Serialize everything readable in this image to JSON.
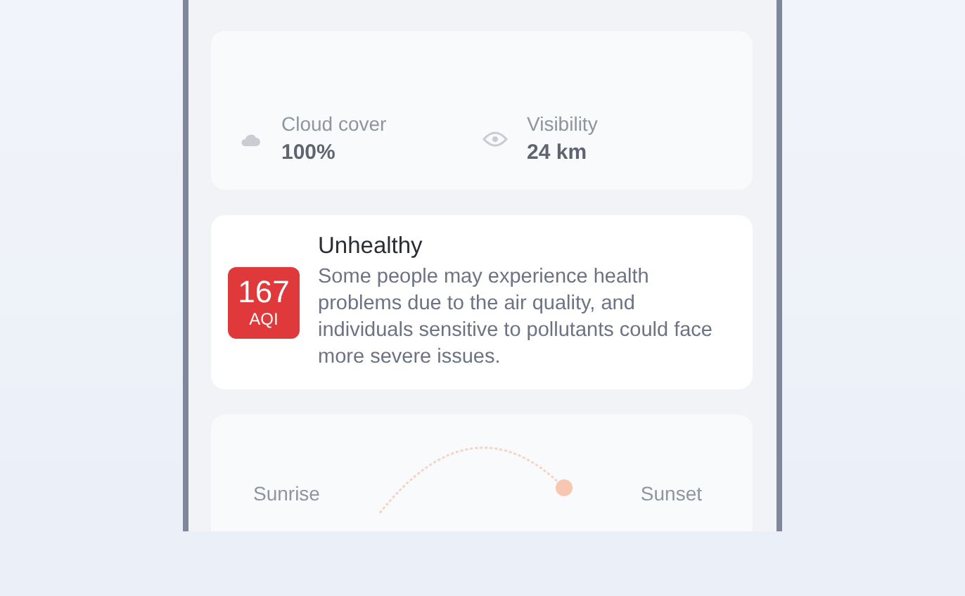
{
  "conditions": [
    {
      "label": "Cloud cover",
      "value": "100%",
      "kind": "cloud"
    },
    {
      "label": "Visibility",
      "value": "24 km",
      "kind": "eye"
    }
  ],
  "air_quality": {
    "index": "167",
    "unit": "AQI",
    "title": "Unhealthy",
    "description": "Some people may experience health problems due to the air quality, and individuals sensitive to pollutants could face more severe issues.",
    "color": "#e0393b"
  },
  "sun": {
    "sunrise_label": "Sunrise",
    "sunset_label": "Sunset"
  }
}
